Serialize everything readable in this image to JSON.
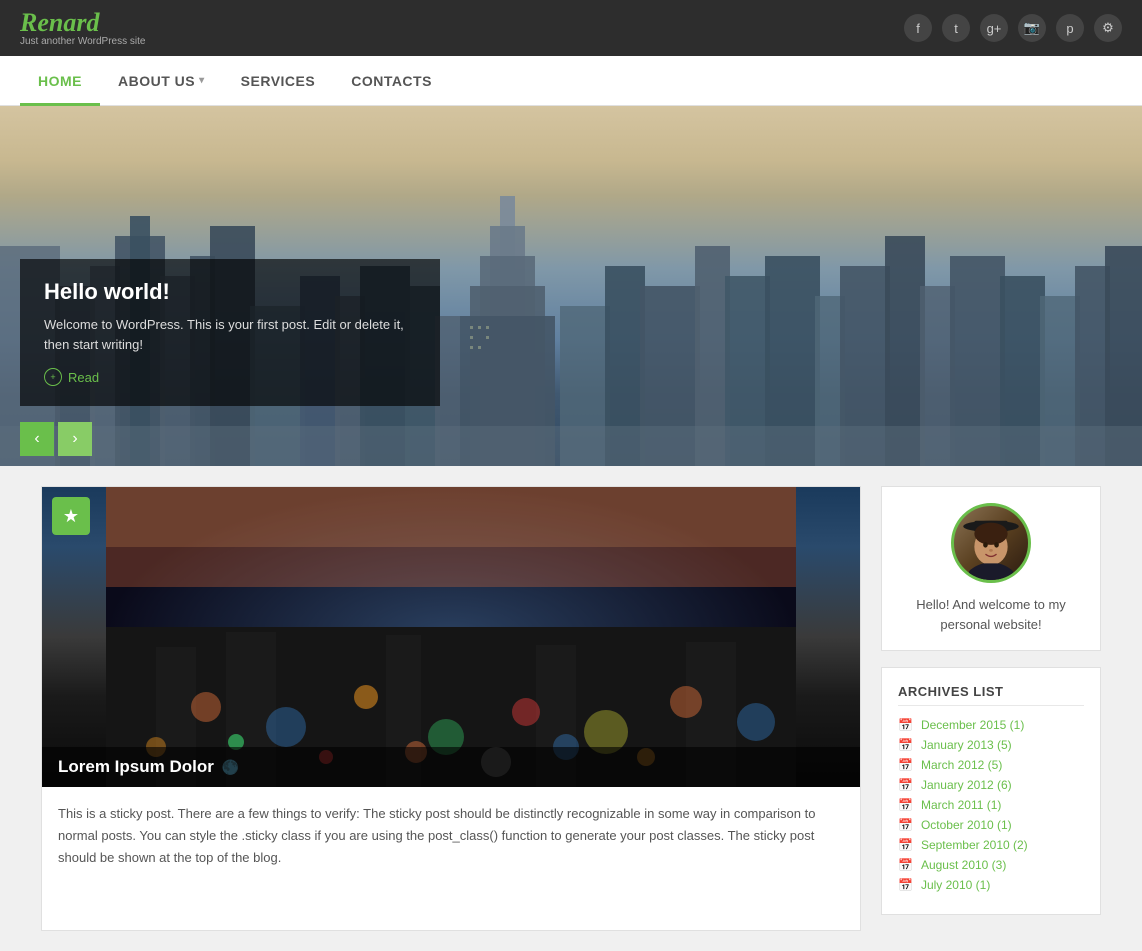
{
  "site": {
    "logo": "Renard",
    "tagline": "Just another WordPress site"
  },
  "social_icons": [
    {
      "name": "facebook-icon",
      "symbol": "f"
    },
    {
      "name": "twitter-icon",
      "symbol": "t"
    },
    {
      "name": "googleplus-icon",
      "symbol": "g+"
    },
    {
      "name": "instagram-icon",
      "symbol": "📷"
    },
    {
      "name": "pinterest-icon",
      "symbol": "p"
    },
    {
      "name": "settings-icon",
      "symbol": "⚙"
    }
  ],
  "nav": {
    "items": [
      {
        "label": "HOME",
        "active": true
      },
      {
        "label": "ABOUT US",
        "dropdown": true
      },
      {
        "label": "SERVICES"
      },
      {
        "label": "CONTACTS"
      }
    ]
  },
  "hero": {
    "title": "Hello world!",
    "description": "Welcome to WordPress. This is your first post. Edit or delete it, then start writing!",
    "read_label": "Read",
    "prev_arrow": "‹",
    "next_arrow": "›"
  },
  "blog_post": {
    "sticky_icon": "★",
    "image_title": "Lorem Ipsum Dolor",
    "body_text": "This is a sticky post. There are a few things to verify: The sticky post should be distinctly recognizable in some way in comparison to normal posts. You can style the .sticky class if you are using the post_class() function to generate your post classes. The sticky post should be shown at the top of the blog."
  },
  "sidebar": {
    "author_text": "Hello! And welcome to my personal website!",
    "archives_title": "ARCHIVES LIST",
    "archives": [
      {
        "label": "December 2015 (1)"
      },
      {
        "label": "January 2013 (5)"
      },
      {
        "label": "March 2012 (5)"
      },
      {
        "label": "January 2012 (6)"
      },
      {
        "label": "March 2011 (1)"
      },
      {
        "label": "October 2010 (1)"
      },
      {
        "label": "September 2010 (2)"
      },
      {
        "label": "August 2010 (3)"
      },
      {
        "label": "July 2010 (1)"
      }
    ]
  }
}
